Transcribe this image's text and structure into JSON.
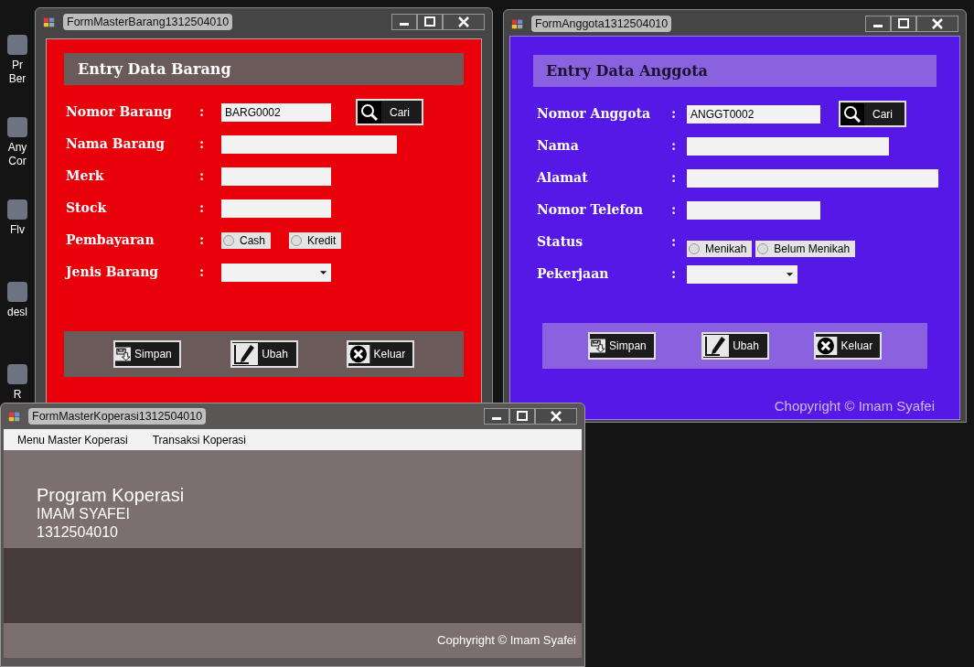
{
  "desktop_icons": [
    {
      "lines": [
        "Pr",
        "Ber"
      ]
    },
    {
      "lines": [
        "Any",
        "Cor"
      ]
    },
    {
      "lines": [
        "Flv"
      ]
    },
    {
      "lines": [
        "desl"
      ]
    },
    {
      "lines": [
        "R"
      ]
    }
  ],
  "barang_window": {
    "title": "FormMasterBarang1312504010",
    "heading": "Entry Data Barang",
    "fields": [
      {
        "label": "Nomor Barang",
        "colon": ":",
        "kind": "text",
        "value": "BARG0002",
        "search_button": {
          "label": "Cari"
        }
      },
      {
        "label": "Nama Barang",
        "colon": ":",
        "kind": "text"
      },
      {
        "label": "Merk",
        "colon": ":",
        "kind": "text"
      },
      {
        "label": "Stock",
        "colon": ":",
        "kind": "text"
      },
      {
        "label": "Pembayaran",
        "colon": ":",
        "kind": "radio",
        "options": [
          {
            "label": "Cash",
            "selected": false
          },
          {
            "label": "Kredit",
            "selected": false
          }
        ]
      },
      {
        "label": "Jenis Barang",
        "colon": ":",
        "kind": "combo"
      }
    ],
    "buttons": [
      {
        "label": "Simpan",
        "kind": "save"
      },
      {
        "label": "Ubah",
        "kind": "edit"
      },
      {
        "label": "Keluar",
        "kind": "exit"
      }
    ]
  },
  "anggota_window": {
    "title": "FormAnggota1312504010",
    "heading": "Entry Data Anggota",
    "fields": [
      {
        "label": "Nomor Anggota",
        "colon": ":",
        "kind": "text",
        "value": "ANGGT0002",
        "search_button": {
          "label": "Cari"
        }
      },
      {
        "label": "Nama",
        "colon": ":",
        "kind": "text"
      },
      {
        "label": "Alamat",
        "colon": ":",
        "kind": "text"
      },
      {
        "label": "Nomor Telefon",
        "colon": ":",
        "kind": "text"
      },
      {
        "label": "Status",
        "colon": ":",
        "kind": "radio",
        "options": [
          {
            "label": "Menikah",
            "selected": false
          },
          {
            "label": "Belum Menikah",
            "selected": false
          }
        ]
      },
      {
        "label": "Pekerjaan",
        "colon": ":",
        "kind": "combo"
      }
    ],
    "buttons": [
      {
        "label": "Simpan",
        "kind": "save"
      },
      {
        "label": "Ubah",
        "kind": "edit"
      },
      {
        "label": "Keluar",
        "kind": "exit"
      }
    ],
    "copyright": "Chopyright © Imam Syafei"
  },
  "koperasi_window": {
    "title": "FormMasterKoperasi1312504010",
    "menu": [
      "Menu Master Koperasi",
      "Transaksi Koperasi"
    ],
    "program_title": "Program Koperasi",
    "author": "IMAM SYAFEI",
    "student_id": "1312504010",
    "copyright": "Cophyright © Imam Syafei"
  }
}
